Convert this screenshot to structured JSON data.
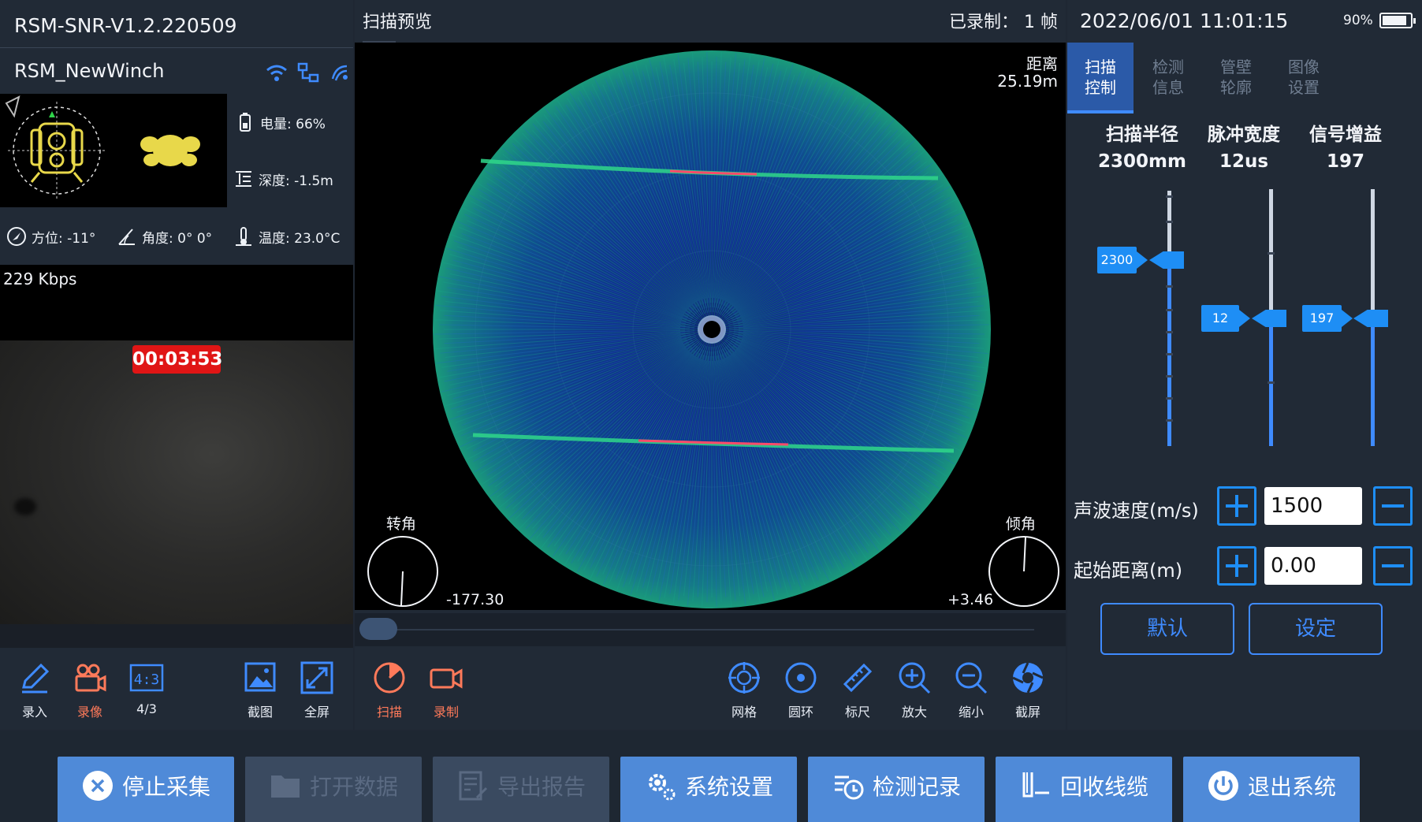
{
  "left_panel": {
    "firmware": "RSM-SNR-V1.2.220509",
    "device_name": "RSM_NewWinch",
    "stats": {
      "battery": "电量: 66%",
      "depth": "深度: -1.5m",
      "azimuth": "方位: -11°",
      "angle": "角度: 0° 0°",
      "temperature": "温度: 23.0°C"
    },
    "bitrate": "229 Kbps",
    "timer": "00:03:53",
    "tools": [
      {
        "label": "录入"
      },
      {
        "label": "录像"
      },
      {
        "label": "4/3",
        "glyph": "4:3"
      },
      {
        "label": "截图"
      },
      {
        "label": "全屏"
      }
    ]
  },
  "center_panel": {
    "title": "扫描预览",
    "recorded": "已录制：  1  帧",
    "distance_label": "距离",
    "distance_value": "25.19m",
    "rotation_label": "转角",
    "rotation_value": "-177.30",
    "tilt_label": "倾角",
    "tilt_value": "+3.46",
    "tools": [
      {
        "label": "扫描"
      },
      {
        "label": "录制"
      },
      {
        "label": "网格"
      },
      {
        "label": "圆环"
      },
      {
        "label": "标尺"
      },
      {
        "label": "放大"
      },
      {
        "label": "缩小"
      },
      {
        "label": "截屏"
      }
    ]
  },
  "right_panel": {
    "datetime": "2022/06/01 11:01:15",
    "battery": "90%",
    "battery_level": 0.9,
    "tabs": [
      {
        "line1": "扫描",
        "line2": "控制"
      },
      {
        "line1": "检测",
        "line2": "信息"
      },
      {
        "line1": "管壁",
        "line2": "轮廓"
      },
      {
        "line1": "图像",
        "line2": "设置"
      }
    ],
    "params": [
      {
        "name": "扫描半径",
        "value": "2300mm",
        "tag": "2300"
      },
      {
        "name": "脉冲宽度",
        "value": "12us",
        "tag": "12"
      },
      {
        "name": "信号增益",
        "value": "197",
        "tag": "197"
      }
    ],
    "sound_speed_label": "声波速度(m/s)",
    "sound_speed_value": "1500",
    "start_distance_label": "起始距离(m)",
    "start_distance_value": "0.00",
    "default_button": "默认",
    "set_button": "设定"
  },
  "bottom_bar": {
    "buttons": [
      {
        "label": "停止采集"
      },
      {
        "label": "打开数据"
      },
      {
        "label": "导出报告"
      },
      {
        "label": "系统设置"
      },
      {
        "label": "检测记录"
      },
      {
        "label": "回收线缆"
      },
      {
        "label": "退出系统"
      }
    ]
  },
  "colors": {
    "accent": "#1e8ef5",
    "panel": "#212a36",
    "record_red": "#e01515",
    "active_tool": "#ff7a5a"
  }
}
